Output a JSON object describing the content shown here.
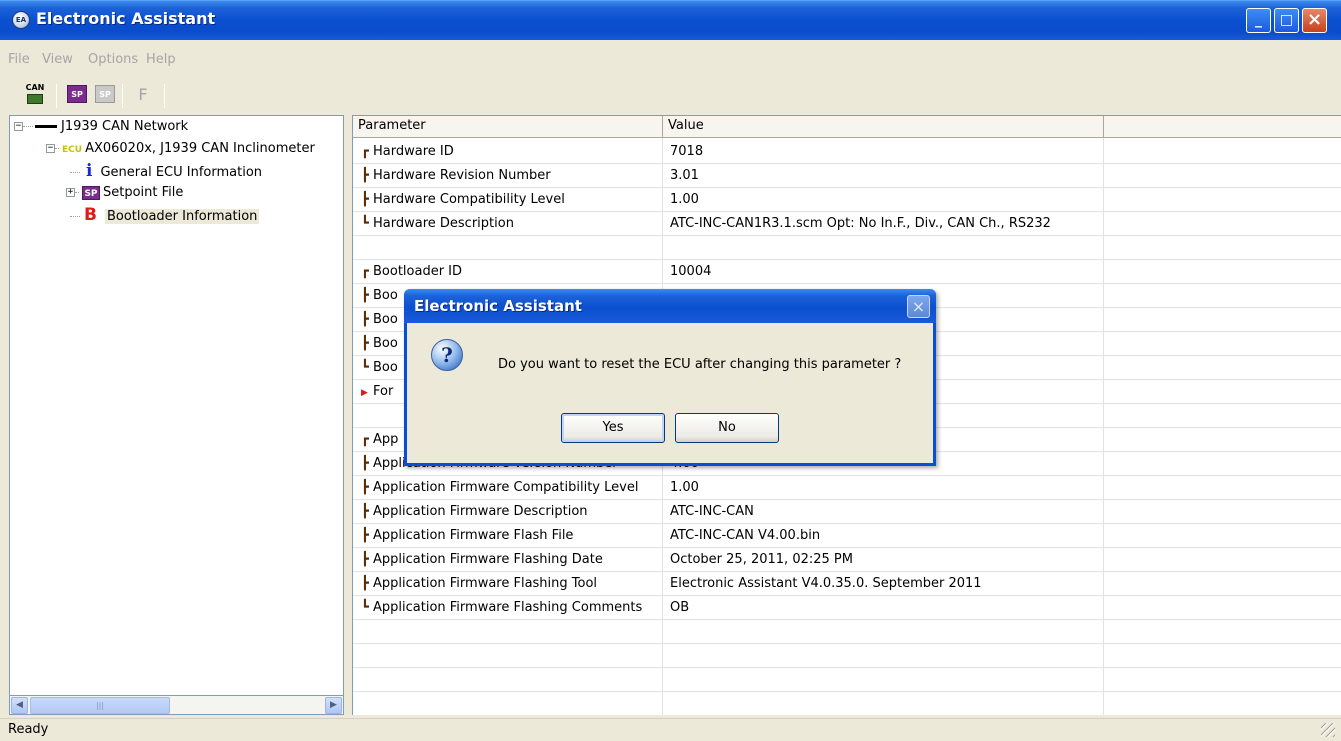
{
  "window": {
    "title": "Electronic Assistant",
    "icon": "EA",
    "controls": {
      "minimize": "_",
      "maximize": "□",
      "close": "×"
    }
  },
  "menu": [
    "File",
    "View",
    "Options",
    "Help"
  ],
  "toolbar": {
    "can_label": "CAN",
    "sp1_label": "SP",
    "sp2_label": "SP",
    "f_label": "F"
  },
  "tree": {
    "network": "J1939 CAN Network",
    "ecu_tag": "ECU",
    "ecu": "AX06020x, J1939 CAN Inclinometer",
    "info_icon": "i",
    "general": "General ECU Information",
    "sp_tag": "SP",
    "setpoint": "Setpoint File",
    "boot_icon": "B",
    "bootloader": "Bootloader Information"
  },
  "grid": {
    "headers": [
      "Parameter",
      "Value"
    ],
    "rows": [
      {
        "param": "Hardware ID",
        "value": "7018"
      },
      {
        "param": "Hardware Revision Number",
        "value": "3.01"
      },
      {
        "param": "Hardware Compatibility Level",
        "value": "1.00"
      },
      {
        "param": "Hardware Description",
        "value": "ATC-INC-CAN1R3.1.scm Opt: No In.F., Div., CAN Ch., RS232"
      },
      {
        "param": "",
        "value": ""
      },
      {
        "param": "Bootloader ID",
        "value": "10004"
      },
      {
        "param": "Boo",
        "value": ""
      },
      {
        "param": "Boo",
        "value": ""
      },
      {
        "param": "Boo",
        "value": ""
      },
      {
        "param": "Boo",
        "value": ""
      },
      {
        "param": "For",
        "value": ""
      },
      {
        "param": "",
        "value": ""
      },
      {
        "param": "App",
        "value": ""
      },
      {
        "param": "Application Firmware Version Number",
        "value": "4.00"
      },
      {
        "param": "Application Firmware Compatibility Level",
        "value": "1.00"
      },
      {
        "param": "Application Firmware Description",
        "value": "ATC-INC-CAN"
      },
      {
        "param": "Application Firmware Flash File",
        "value": "ATC-INC-CAN V4.00.bin"
      },
      {
        "param": "Application Firmware Flashing Date",
        "value": "October 25, 2011, 02:25 PM"
      },
      {
        "param": "Application Firmware Flashing Tool",
        "value": "Electronic Assistant V4.0.35.0. September 2011"
      },
      {
        "param": "Application Firmware Flashing Comments",
        "value": "OB"
      }
    ]
  },
  "status": {
    "text": "Ready"
  },
  "dialog": {
    "title": "Electronic Assistant",
    "message": "Do you want to reset the ECU after changing this parameter ?",
    "icon": "?",
    "yes": "Yes",
    "no": "No",
    "close": "×"
  }
}
